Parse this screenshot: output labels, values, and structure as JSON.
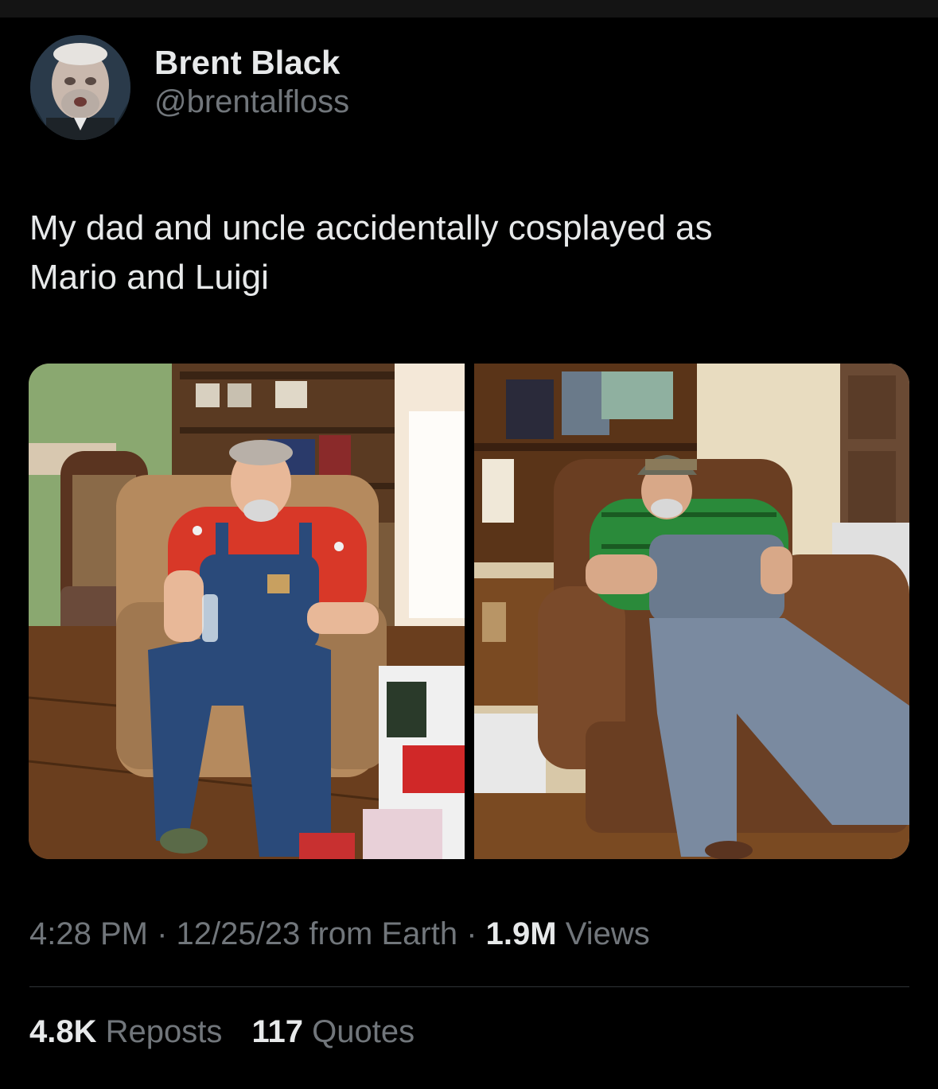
{
  "author": {
    "display_name": "Brent Black",
    "handle": "@brentalfloss"
  },
  "tweet": {
    "text": "My dad and uncle accidentally cosplayed as\nMario and Luigi"
  },
  "media": {
    "count": 2
  },
  "meta": {
    "time": "4:28 PM",
    "separator": "·",
    "date": "12/25/23",
    "source": "from Earth",
    "views_count": "1.9M",
    "views_label": "Views"
  },
  "stats": {
    "reposts_count": "4.8K",
    "reposts_label": "Reposts",
    "quotes_count": "117",
    "quotes_label": "Quotes"
  },
  "colors": {
    "background": "#000000",
    "primary_text": "#e7e9ea",
    "secondary_text": "#71767b",
    "divider": "#2f3336"
  }
}
